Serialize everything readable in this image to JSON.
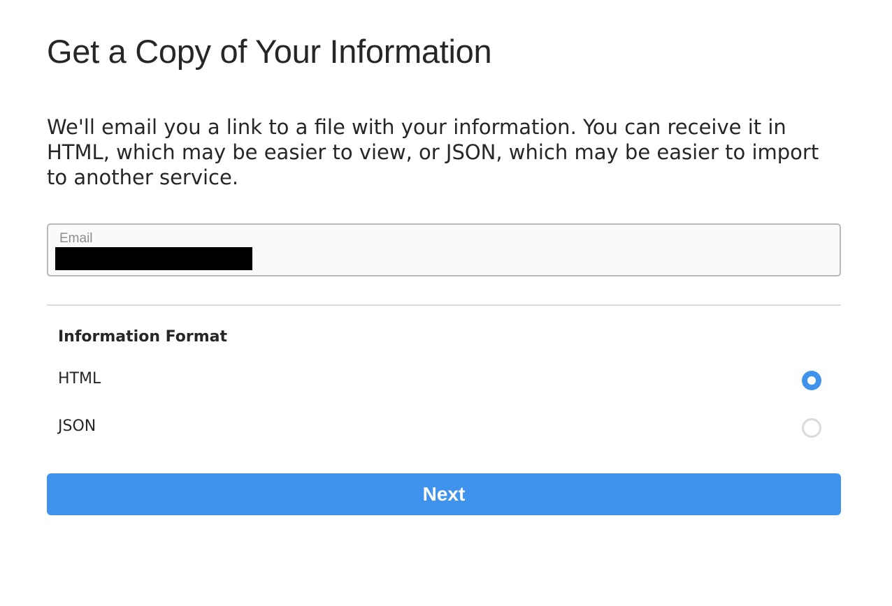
{
  "page": {
    "title": "Get a Copy of Your Information",
    "description": "We'll email you a link to a file with your information. You can receive it in HTML, which may be easier to view, or JSON, which may be easier to import to another service."
  },
  "email_field": {
    "label": "Email",
    "value": ""
  },
  "format": {
    "heading": "Information Format",
    "options": [
      {
        "label": "HTML",
        "selected": true
      },
      {
        "label": "JSON",
        "selected": false
      }
    ]
  },
  "actions": {
    "next_label": "Next"
  },
  "colors": {
    "accent": "#4093ec",
    "text": "#262626",
    "muted": "#8e8e8e",
    "border": "#dbdbdb"
  }
}
